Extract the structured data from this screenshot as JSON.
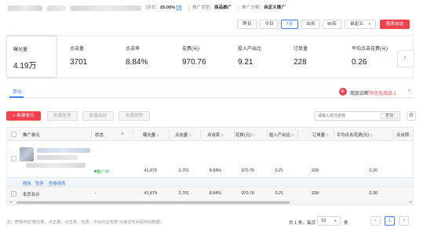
{
  "info_bar": {
    "discount_label": "|折扣：",
    "discount_value": "65.00%",
    "promo_type_label": "推广类型：",
    "promo_type_value": "商品推广",
    "promo_plan_label": "推广方案：",
    "promo_plan_value": "自定义推广"
  },
  "date_range": {
    "buttons": [
      "昨日",
      "今日",
      "7天",
      "30天",
      "90天"
    ],
    "active": "7天",
    "custom_label": "自定义",
    "download_label": "报表自选"
  },
  "metrics": [
    {
      "label": "曝光量",
      "value": "4.19万"
    },
    {
      "label": "点击量",
      "value": "3701"
    },
    {
      "label": "点击率",
      "value": "8.84%"
    },
    {
      "label": "花费(元)",
      "value": "970.76"
    },
    {
      "label": "投入产出比",
      "value": "9.21"
    },
    {
      "label": "订单量",
      "value": "228"
    },
    {
      "label": "平均点击花费(元)",
      "value": "0.26"
    }
  ],
  "tabs": {
    "active_label": "单元"
  },
  "diagnosis": {
    "prefix": "商品诊断",
    "link": "待优化商品",
    "count": "1"
  },
  "actions": {
    "new_unit": "+ 新建单元",
    "batch_pause": "批量暂停",
    "batch_start": "批量启动",
    "batch_delete": "批量删除",
    "search_placeholder": "请输入单元名称",
    "search_button": "查询"
  },
  "table": {
    "headers": [
      "推广单元",
      "状态",
      "曝光量",
      "点击量",
      "点击率",
      "花费(元)",
      "投入产出比",
      "订单量",
      "平均点击花费(元)",
      "点击转"
    ],
    "row": {
      "status": "推广中",
      "impressions": "41,879",
      "clicks": "3,701",
      "ctr": "8.84%",
      "cost": "970.76",
      "roi": "9.21",
      "orders": "228",
      "avg_cpc": "0.26"
    },
    "row_actions": [
      "删除",
      "暂停",
      "查看报表"
    ],
    "total": {
      "label": "本页合计",
      "status": "-",
      "impressions": "41,879",
      "clicks": "3,701",
      "ctr": "8.84%",
      "cost": "970.76",
      "roi": "9.21",
      "orders": "228",
      "avg_cpc": "0.26"
    }
  },
  "footer": {
    "note": "注：表格中的\"曝光量、点击量、点击率、花费、平均点击花费\"为接近时间段内的数据。",
    "total_text": "共 1 条，每页",
    "page_size": "10",
    "per_page_unit": "条",
    "prev": "<",
    "current_page": "1",
    "next": ">"
  },
  "colors": {
    "primary_blue": "#3d7ff5",
    "brand_red": "#f3424d",
    "status_green": "#2db34a"
  }
}
